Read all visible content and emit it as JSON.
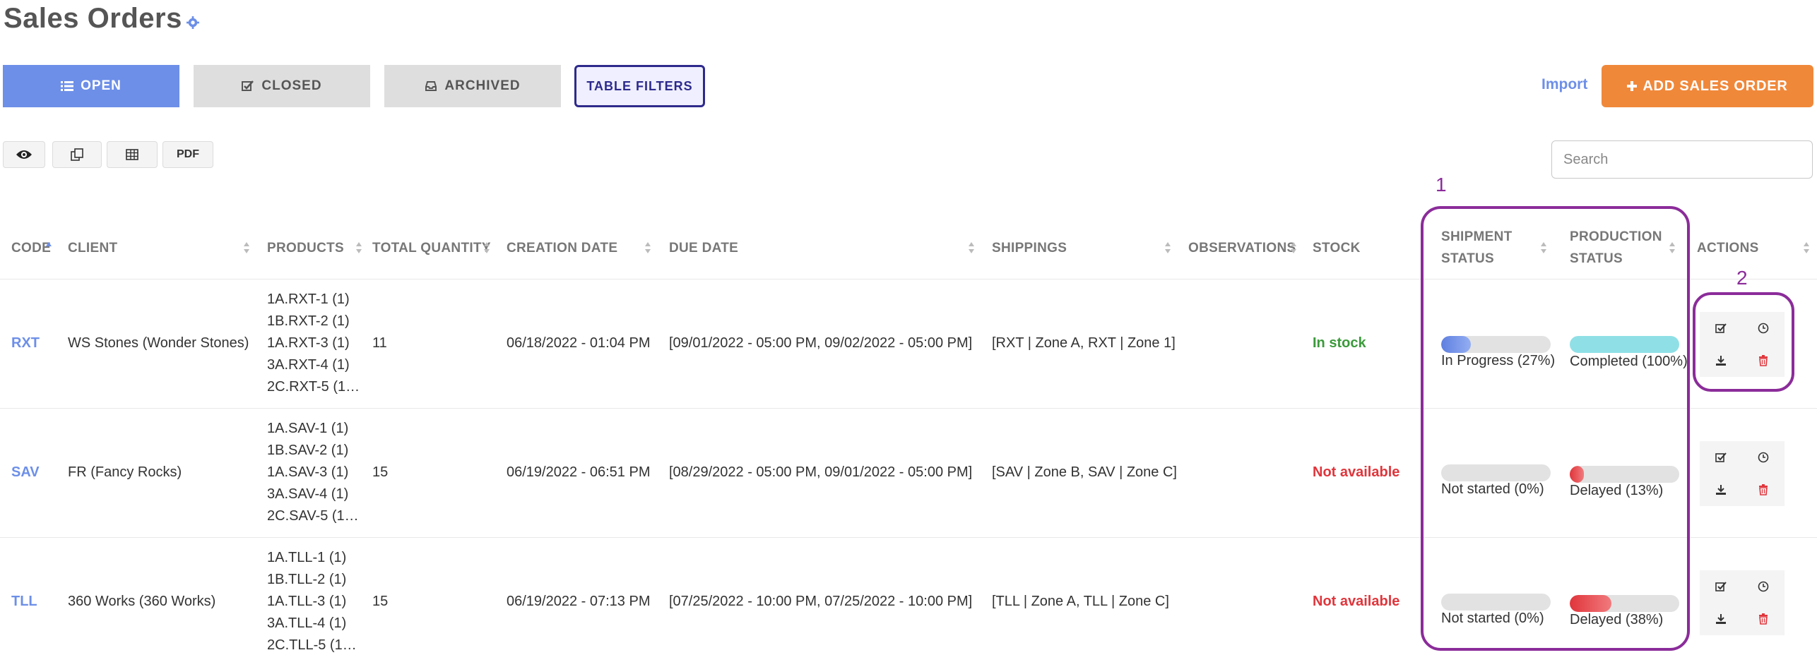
{
  "page": {
    "title": "Sales Orders"
  },
  "tabs": {
    "open": "OPEN",
    "closed": "CLOSED",
    "archived": "ARCHIVED",
    "filters": "TABLE FILTERS"
  },
  "header_actions": {
    "import": "Import",
    "add": "ADD SALES ORDER"
  },
  "toolbar": {
    "pdf": "PDF"
  },
  "search": {
    "placeholder": "Search",
    "value": ""
  },
  "columns": {
    "code": "CODE",
    "client": "CLIENT",
    "products": "PRODUCTS",
    "total_quantity": "TOTAL QUANTITY",
    "creation_date": "CREATION DATE",
    "due_date": "DUE DATE",
    "shippings": "SHIPPINGS",
    "observations": "OBSERVATIONS",
    "stock": "STOCK",
    "shipment_status_1": "SHIPMENT",
    "shipment_status_2": "STATUS",
    "production_status_1": "PRODUCTION",
    "production_status_2": "STATUS",
    "actions": "ACTIONS"
  },
  "rows": [
    {
      "code": "RXT",
      "client": "WS Stones (Wonder Stones)",
      "products": [
        "1A.RXT-1 (1)",
        "1B.RXT-2 (1)",
        "1A.RXT-3 (1)",
        "3A.RXT-4 (1)",
        "2C.RXT-5 (1…"
      ],
      "quantity": "11",
      "creation": "06/18/2022 - 01:04 PM",
      "due": "[09/01/2022 - 05:00 PM, 09/02/2022 - 05:00 PM]",
      "shippings": "[RXT | Zone A, RXT | Zone 1]",
      "observations": "",
      "stock": "In stock",
      "shipment_label": "In Progress (27%)",
      "shipment_pct": 27,
      "production_label": "Completed (100%)",
      "production_pct": 100
    },
    {
      "code": "SAV",
      "client": "FR (Fancy Rocks)",
      "products": [
        "1A.SAV-1 (1)",
        "1B.SAV-2 (1)",
        "1A.SAV-3 (1)",
        "3A.SAV-4 (1)",
        "2C.SAV-5 (1…"
      ],
      "quantity": "15",
      "creation": "06/19/2022 - 06:51 PM",
      "due": "[08/29/2022 - 05:00 PM, 09/01/2022 - 05:00 PM]",
      "shippings": "[SAV | Zone B, SAV | Zone C]",
      "observations": "",
      "stock": "Not available",
      "shipment_label": "Not started (0%)",
      "shipment_pct": 0,
      "production_label": "Delayed (13%)",
      "production_pct": 13
    },
    {
      "code": "TLL",
      "client": "360 Works (360 Works)",
      "products": [
        "1A.TLL-1 (1)",
        "1B.TLL-2 (1)",
        "1A.TLL-3 (1)",
        "3A.TLL-4 (1)",
        "2C.TLL-5 (1…"
      ],
      "quantity": "15",
      "creation": "06/19/2022 - 07:13 PM",
      "due": "[07/25/2022 - 10:00 PM, 07/25/2022 - 10:00 PM]",
      "shippings": "[TLL | Zone A, TLL | Zone C]",
      "observations": "",
      "stock": "Not available",
      "shipment_label": "Not started (0%)",
      "shipment_pct": 0,
      "production_label": "Delayed (38%)",
      "production_pct": 38
    }
  ],
  "annotations": {
    "label_1": "1",
    "label_2": "2"
  },
  "colors": {
    "accent": "#6d8fe8",
    "add": "#f0883a",
    "ok": "#3a9a3a",
    "error": "#e0353b",
    "completed": "#8ee0e6",
    "annotation": "#8b2c9a"
  },
  "icons": {
    "title": "gear-icon",
    "open": "list-icon",
    "closed": "checkbox-icon",
    "archived": "inbox-icon",
    "add": "plus-icon",
    "view": "eye-icon",
    "copy": "copy-icon",
    "table": "table-icon",
    "approve": "check-icon",
    "history": "clock-icon",
    "download": "download-icon",
    "delete": "trash-icon"
  }
}
